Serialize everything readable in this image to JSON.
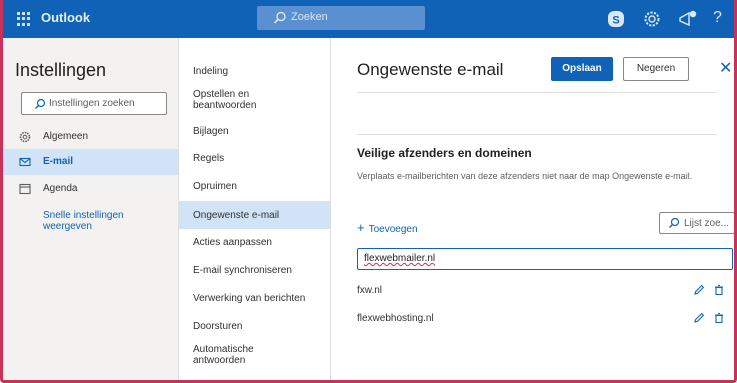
{
  "topbar": {
    "app_name": "Outlook",
    "search_placeholder": "Zoeken",
    "icons": [
      "waffle-icon",
      "search-icon",
      "skype-icon",
      "gear-icon",
      "megaphone-icon",
      "help-icon"
    ],
    "help_glyph": "?"
  },
  "left": {
    "title": "Instellingen",
    "search_placeholder": "Instellingen zoeken",
    "items": [
      {
        "label": "Algemeen",
        "icon": "gear-icon"
      },
      {
        "label": "E-mail",
        "icon": "mail-icon",
        "selected": true
      },
      {
        "label": "Agenda",
        "icon": "calendar-icon"
      }
    ],
    "quick_settings": "Snelle instellingen weergeven"
  },
  "middle": {
    "items": [
      {
        "label": "Indeling"
      },
      {
        "label": "Opstellen en beantwoorden"
      },
      {
        "label": "Bijlagen"
      },
      {
        "label": "Regels"
      },
      {
        "label": "Opruimen"
      },
      {
        "label": "Ongewenste e-mail",
        "selected": true
      },
      {
        "label": "Acties aanpassen"
      },
      {
        "label": "E-mail synchroniseren"
      },
      {
        "label": "Verwerking van berichten"
      },
      {
        "label": "Doorsturen"
      },
      {
        "label": "Automatische antwoorden"
      }
    ]
  },
  "right": {
    "title": "Ongewenste e-mail",
    "save_label": "Opslaan",
    "discard_label": "Negeren",
    "close_glyph": "✕",
    "section_title": "Veilige afzenders en domeinen",
    "section_desc": "Verplaats e-mailberichten van deze afzenders niet naar de map Ongewenste e-mail.",
    "add_label": "Toevoegen",
    "add_glyph": "+",
    "list_search_placeholder": "Lijst zoe...",
    "entry_value": "flexwebmailer.nl",
    "senders": [
      "fxw.nl",
      "flexwebhosting.nl"
    ]
  },
  "colors": {
    "brand_blue": "#0f62b5",
    "selected_bg": "#d0e3f7",
    "frame_accent": "#c8325a"
  }
}
